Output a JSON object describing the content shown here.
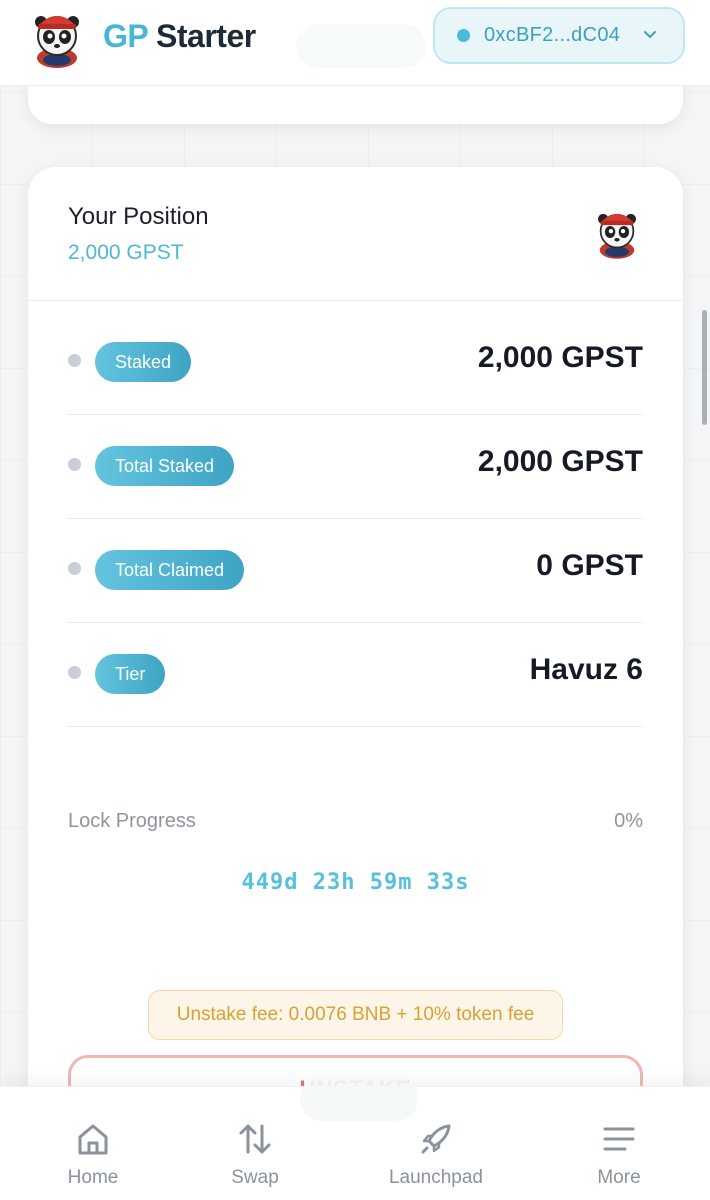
{
  "header": {
    "brand_gp": "GP",
    "brand_starter": "Starter",
    "logo_icon": "panda-mascot-icon",
    "wallet": {
      "address": "0xcBF2...dC04",
      "status_color": "#4bbbd9"
    }
  },
  "position": {
    "title": "Your Position",
    "amount": "2,000 GPST",
    "rows": [
      {
        "label": "Staked",
        "value": "2,000 GPST"
      },
      {
        "label": "Total Staked",
        "value": "2,000 GPST"
      },
      {
        "label": "Total Claimed",
        "value": "0 GPST"
      },
      {
        "label": "Tier",
        "value": "Havuz 6"
      }
    ],
    "lock": {
      "label": "Lock Progress",
      "percent_text": "0%",
      "progress": 0
    },
    "countdown": "449d 23h 59m 33s",
    "fee_note": "Unstake fee: 0.0076 BNB + 10% token fee",
    "unstake_label": "UNSTAKE"
  },
  "nav": {
    "items": [
      {
        "label": "Home",
        "icon": "home-icon"
      },
      {
        "label": "Swap",
        "icon": "swap-icon"
      },
      {
        "label": "Launchpad",
        "icon": "rocket-icon"
      },
      {
        "label": "More",
        "icon": "menu-icon"
      }
    ]
  },
  "colors": {
    "accent": "#45b6d6",
    "tag_gradient_start": "#63c4de",
    "tag_gradient_end": "#3ea4c4",
    "fee_text": "#d9a133",
    "danger": "#e57373"
  }
}
